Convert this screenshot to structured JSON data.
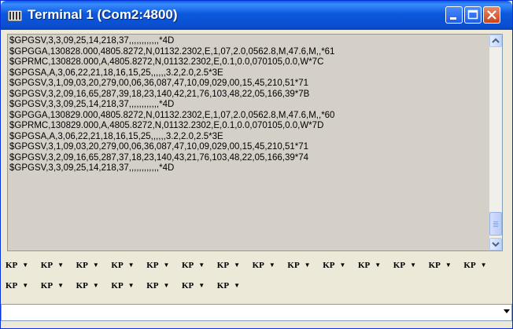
{
  "window": {
    "title": "Terminal 1 (Com2:4800)"
  },
  "title_buttons": {
    "minimize": "minimize-icon",
    "maximize": "maximize-icon",
    "close": "close-icon"
  },
  "output": {
    "lines": [
      "$GPGSV,3,3,09,25,14,218,37,,,,,,,,,,,,*4D",
      "$GPGGA,130828.000,4805.8272,N,01132.2302,E,1,07,2.0,0562.8,M,47.6,M,,*61",
      "$GPRMC,130828.000,A,4805.8272,N,01132.2302,E,0.1,0.0,070105,0.0,W*7C",
      "$GPGSA,A,3,06,22,21,18,16,15,25,,,,,,3.2,2.0,2.5*3E",
      "$GPGSV,3,1,09,03,20,279,00,06,36,087,47,10,09,029,00,15,45,210,51*71",
      "$GPGSV,3,2,09,16,65,287,39,18,23,140,42,21,76,103,48,22,05,166,39*7B",
      "$GPGSV,3,3,09,25,14,218,37,,,,,,,,,,,,*4D",
      "$GPGGA,130829.000,4805.8272,N,01132.2302,E,1,07,2.0,0562.8,M,47.6,M,,*60",
      "$GPRMC,130829.000,A,4805.8272,N,01132.2302,E,0.1,0.0,070105,0.0,W*7D",
      "$GPGSA,A,3,06,22,21,18,16,15,25,,,,,,3.2,2.0,2.5*3E",
      "$GPGSV,3,1,09,03,20,279,00,06,36,087,47,10,09,029,00,15,45,210,51*71",
      "$GPGSV,3,2,09,16,65,287,37,18,23,140,43,21,76,103,48,22,05,166,39*74",
      "$GPGSV,3,3,09,25,14,218,37,,,,,,,,,,,,*4D"
    ]
  },
  "kp_buttons": {
    "label": "KP",
    "row1_count": 14,
    "row2_count": 7
  },
  "input": {
    "value": ""
  },
  "colors": {
    "titlebar": "#0A4FD1",
    "window_bg": "#ECE9D8",
    "output_bg": "#D4D0C8",
    "close_button": "#C9431C"
  }
}
